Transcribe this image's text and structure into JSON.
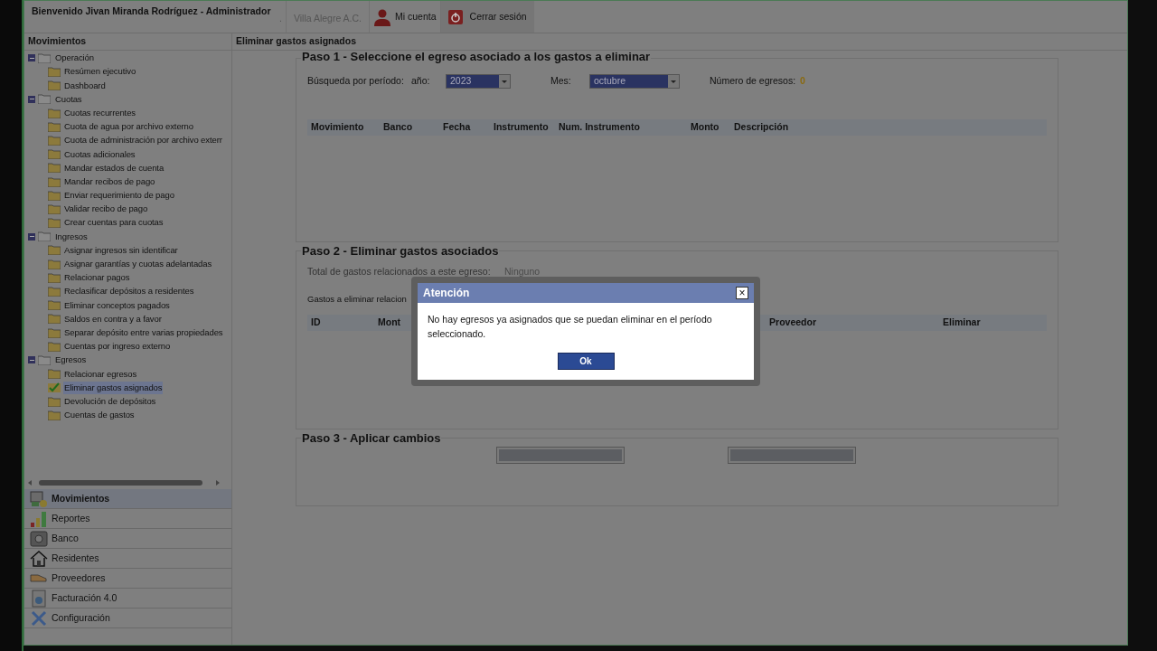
{
  "header": {
    "welcome": "Bienvenido Jivan Miranda Rodríguez - Administrador",
    "separator": ".",
    "company": "Villa Alegre A.C.",
    "account": "Mi cuenta",
    "logout": "Cerrar sesión"
  },
  "sidebar": {
    "title": "Movimientos",
    "tree": [
      {
        "label": "Operación",
        "expanded": true,
        "children": [
          {
            "label": "Resúmen ejecutivo",
            "selected": false
          },
          {
            "label": "Dashboard",
            "selected": false
          }
        ]
      },
      {
        "label": "Cuotas",
        "expanded": true,
        "children": [
          {
            "label": "Cuotas recurrentes",
            "selected": false
          },
          {
            "label": "Cuota de agua por archivo externo",
            "selected": false
          },
          {
            "label": "Cuota de administración por archivo exterr",
            "selected": false
          },
          {
            "label": "Cuotas adicionales",
            "selected": false
          },
          {
            "label": "Mandar estados de cuenta",
            "selected": false
          },
          {
            "label": "Mandar recibos de pago",
            "selected": false
          },
          {
            "label": "Enviar requerimiento de pago",
            "selected": false
          },
          {
            "label": "Validar recibo de pago",
            "selected": false
          },
          {
            "label": "Crear cuentas para cuotas",
            "selected": false
          }
        ]
      },
      {
        "label": "Ingresos",
        "expanded": true,
        "children": [
          {
            "label": "Asignar ingresos sin identificar",
            "selected": false
          },
          {
            "label": "Asignar garantías y cuotas adelantadas",
            "selected": false
          },
          {
            "label": "Relacionar pagos",
            "selected": false
          },
          {
            "label": "Reclasificar depósitos a residentes",
            "selected": false
          },
          {
            "label": "Eliminar conceptos pagados",
            "selected": false
          },
          {
            "label": "Saldos en contra y a favor",
            "selected": false
          },
          {
            "label": "Separar depósito entre varias propiedades",
            "selected": false
          },
          {
            "label": "Cuentas por ingreso externo",
            "selected": false
          }
        ]
      },
      {
        "label": "Egresos",
        "expanded": true,
        "children": [
          {
            "label": "Relacionar egresos",
            "selected": false
          },
          {
            "label": "Eliminar gastos asignados",
            "selected": true
          },
          {
            "label": "Devolución de depósitos",
            "selected": false
          },
          {
            "label": "Cuentas de gastos",
            "selected": false
          }
        ]
      }
    ],
    "nav": [
      {
        "label": "Movimientos",
        "kind": "movements",
        "selected": true
      },
      {
        "label": "Reportes",
        "kind": "reports",
        "selected": false
      },
      {
        "label": "Banco",
        "kind": "bank",
        "selected": false
      },
      {
        "label": "Residentes",
        "kind": "residents",
        "selected": false
      },
      {
        "label": "Proveedores",
        "kind": "suppliers",
        "selected": false
      },
      {
        "label": "Facturación 4.0",
        "kind": "billing",
        "selected": false
      },
      {
        "label": "Configuración",
        "kind": "settings",
        "selected": false
      }
    ]
  },
  "main": {
    "title": "Eliminar gastos asignados",
    "step1": {
      "title": "Paso 1 - Seleccione el egreso asociado a los gastos a eliminar",
      "period_label": "Búsqueda por período:",
      "year_label": "año:",
      "year": "2023",
      "month_label": "Mes:",
      "month": "octubre",
      "count_label": "Número de egresos:",
      "count": "0",
      "columns": [
        "Movimiento",
        "Banco",
        "Fecha",
        "Instrumento",
        "Num. Instrumento",
        "Monto",
        "Descripción"
      ]
    },
    "step2": {
      "title": "Paso 2 - Eliminar gastos asociados",
      "total_label": "Total de gastos relacionados a este egreso:",
      "total_value": "Ninguno",
      "list_label": "Gastos a eliminar relacion",
      "columns": [
        "ID",
        "Mont",
        "Proveedor",
        "Eliminar"
      ]
    },
    "step3": {
      "title": "Paso 3 - Aplicar cambios"
    }
  },
  "dialog": {
    "title": "Atención",
    "close": "×",
    "message": "No hay egresos ya asignados que se puedan eliminar en el período seleccionado.",
    "ok": "Ok"
  }
}
